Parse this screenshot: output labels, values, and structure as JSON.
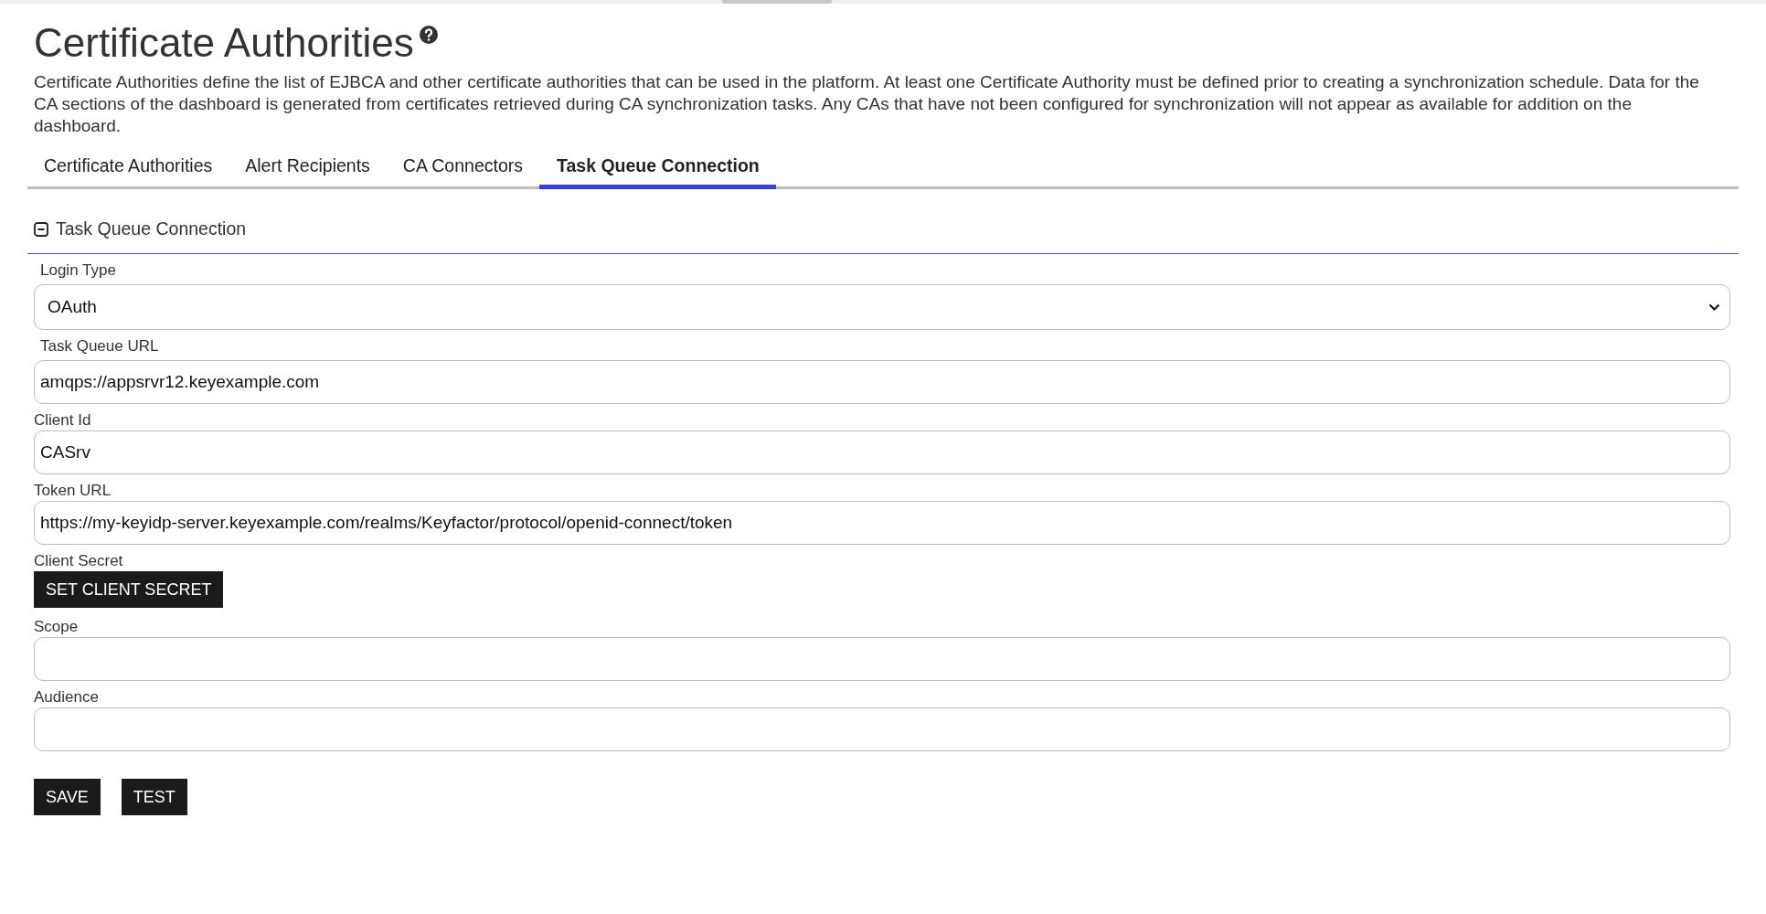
{
  "page": {
    "title": "Certificate Authorities",
    "description": "Certificate Authorities define the list of EJBCA and other certificate authorities that can be used in the platform. At least one Certificate Authority must be defined prior to creating a synchronization schedule. Data for the CA sections of the dashboard is generated from certificates retrieved during CA synchronization tasks. Any CAs that have not been configured for synchronization will not appear as available for addition on the dashboard."
  },
  "tabs": [
    {
      "label": "Certificate Authorities",
      "selected": false
    },
    {
      "label": "Alert Recipients",
      "selected": false
    },
    {
      "label": "CA Connectors",
      "selected": false
    },
    {
      "label": "Task Queue Connection",
      "selected": true
    }
  ],
  "section": {
    "title": "Task Queue Connection",
    "expanded": true
  },
  "fields": [
    {
      "kind": "select",
      "label": "Login Type",
      "value": "OAuth"
    },
    {
      "kind": "text",
      "label": "Task Queue URL",
      "value": "amqps://appsrvr12.keyexample.com"
    },
    {
      "kind": "text",
      "label": "Client Id",
      "value": "CASrv"
    },
    {
      "kind": "text",
      "label": "Token URL",
      "value": "https://my-keyidp-server.keyexample.com/realms/Keyfactor/protocol/openid-connect/token"
    },
    {
      "kind": "button",
      "label": "Client Secret",
      "value": "SET CLIENT SECRET"
    },
    {
      "kind": "text",
      "label": "Scope"
    },
    {
      "kind": "text",
      "label": "Audience"
    }
  ],
  "buttons": [
    "SAVE",
    "TEST"
  ]
}
